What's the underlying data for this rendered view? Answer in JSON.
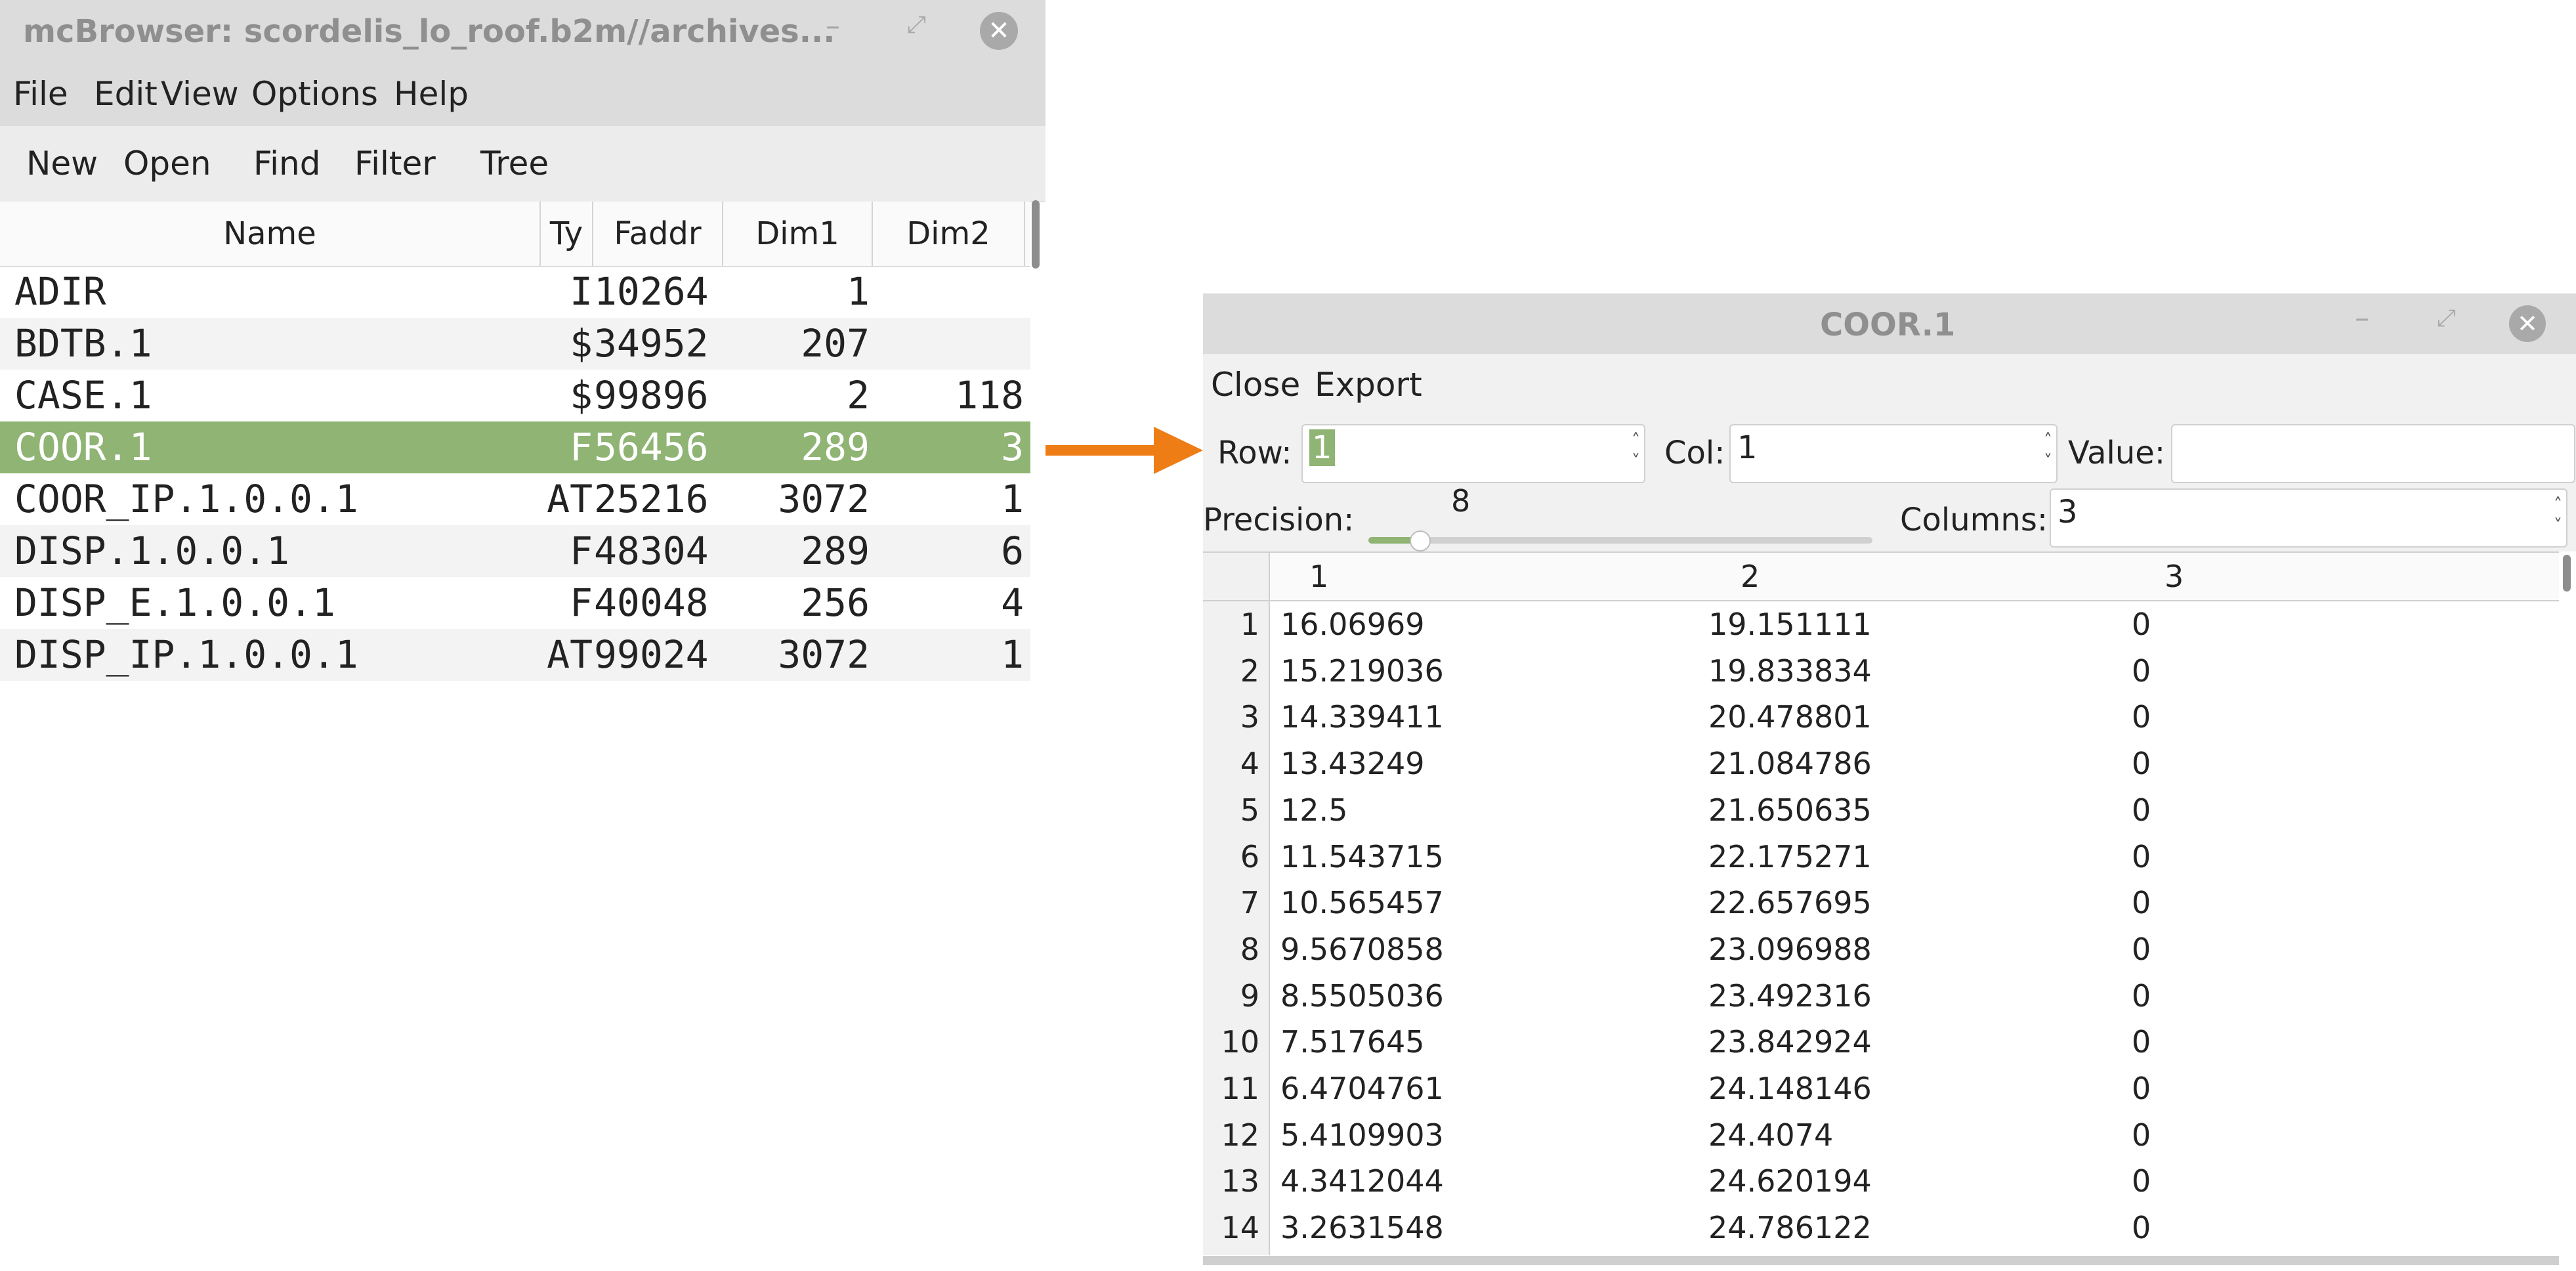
{
  "main_window": {
    "title": "mcBrowser: scordelis_lo_roof.b2m//archives...",
    "menu": [
      "File",
      "Edit",
      "View",
      "Options",
      "Help"
    ],
    "toolbar": [
      "New",
      "Open",
      "Find",
      "Filter",
      "Tree"
    ],
    "columns": [
      "Name",
      "Ty",
      "Faddr",
      "Dim1",
      "Dim2"
    ],
    "rows": [
      {
        "name": "ADIR",
        "ty": "I",
        "faddr": "10264",
        "dim1": "1",
        "dim2": ""
      },
      {
        "name": "BDTB.1",
        "ty": "$",
        "faddr": "34952",
        "dim1": "207",
        "dim2": ""
      },
      {
        "name": "CASE.1",
        "ty": "$",
        "faddr": "99896",
        "dim1": "2",
        "dim2": "118"
      },
      {
        "name": "COOR.1",
        "ty": "F",
        "faddr": "56456",
        "dim1": "289",
        "dim2": "3"
      },
      {
        "name": "COOR_IP.1.0.0.1",
        "ty": "AT",
        "faddr": "25216",
        "dim1": "3072",
        "dim2": "1"
      },
      {
        "name": "DISP.1.0.0.1",
        "ty": "F",
        "faddr": "48304",
        "dim1": "289",
        "dim2": "6"
      },
      {
        "name": "DISP_E.1.0.0.1",
        "ty": "F",
        "faddr": "40048",
        "dim1": "256",
        "dim2": "4"
      },
      {
        "name": "DISP_IP.1.0.0.1",
        "ty": "AT",
        "faddr": "99024",
        "dim1": "3072",
        "dim2": "1"
      }
    ],
    "selected_row": 3
  },
  "coor_window": {
    "title": "COOR.1",
    "menu": [
      "Close",
      "Export"
    ],
    "row_label": "Row:",
    "row_value": "1",
    "col_label": "Col:",
    "col_value": "1",
    "value_label": "Value:",
    "value_value": "",
    "precision_label": "Precision:",
    "precision_value": "8",
    "precision_level": 0.1,
    "columns_label": "Columns:",
    "columns_value": "3",
    "grid_headers": [
      "1",
      "2",
      "3"
    ],
    "grid_rows": [
      [
        "1",
        "16.06969",
        "19.151111",
        "0"
      ],
      [
        "2",
        "15.219036",
        "19.833834",
        "0"
      ],
      [
        "3",
        "14.339411",
        "20.478801",
        "0"
      ],
      [
        "4",
        "13.43249",
        "21.084786",
        "0"
      ],
      [
        "5",
        "12.5",
        "21.650635",
        "0"
      ],
      [
        "6",
        "11.543715",
        "22.175271",
        "0"
      ],
      [
        "7",
        "10.565457",
        "22.657695",
        "0"
      ],
      [
        "8",
        "9.5670858",
        "23.096988",
        "0"
      ],
      [
        "9",
        "8.5505036",
        "23.492316",
        "0"
      ],
      [
        "10",
        "7.517645",
        "23.842924",
        "0"
      ],
      [
        "11",
        "6.4704761",
        "24.148146",
        "0"
      ],
      [
        "12",
        "5.4109903",
        "24.4074",
        "0"
      ],
      [
        "13",
        "4.3412044",
        "24.620194",
        "0"
      ],
      [
        "14",
        "3.2631548",
        "24.786122",
        "0"
      ]
    ]
  },
  "colors": {
    "accent": "#8fb473",
    "arrow": "#ee7d16",
    "chrome": "#dcdcdc"
  },
  "icons": [
    "minimize-icon",
    "maximize-icon",
    "close-icon",
    "spin-up-icon",
    "spin-down-icon",
    "arrow-right-icon"
  ]
}
